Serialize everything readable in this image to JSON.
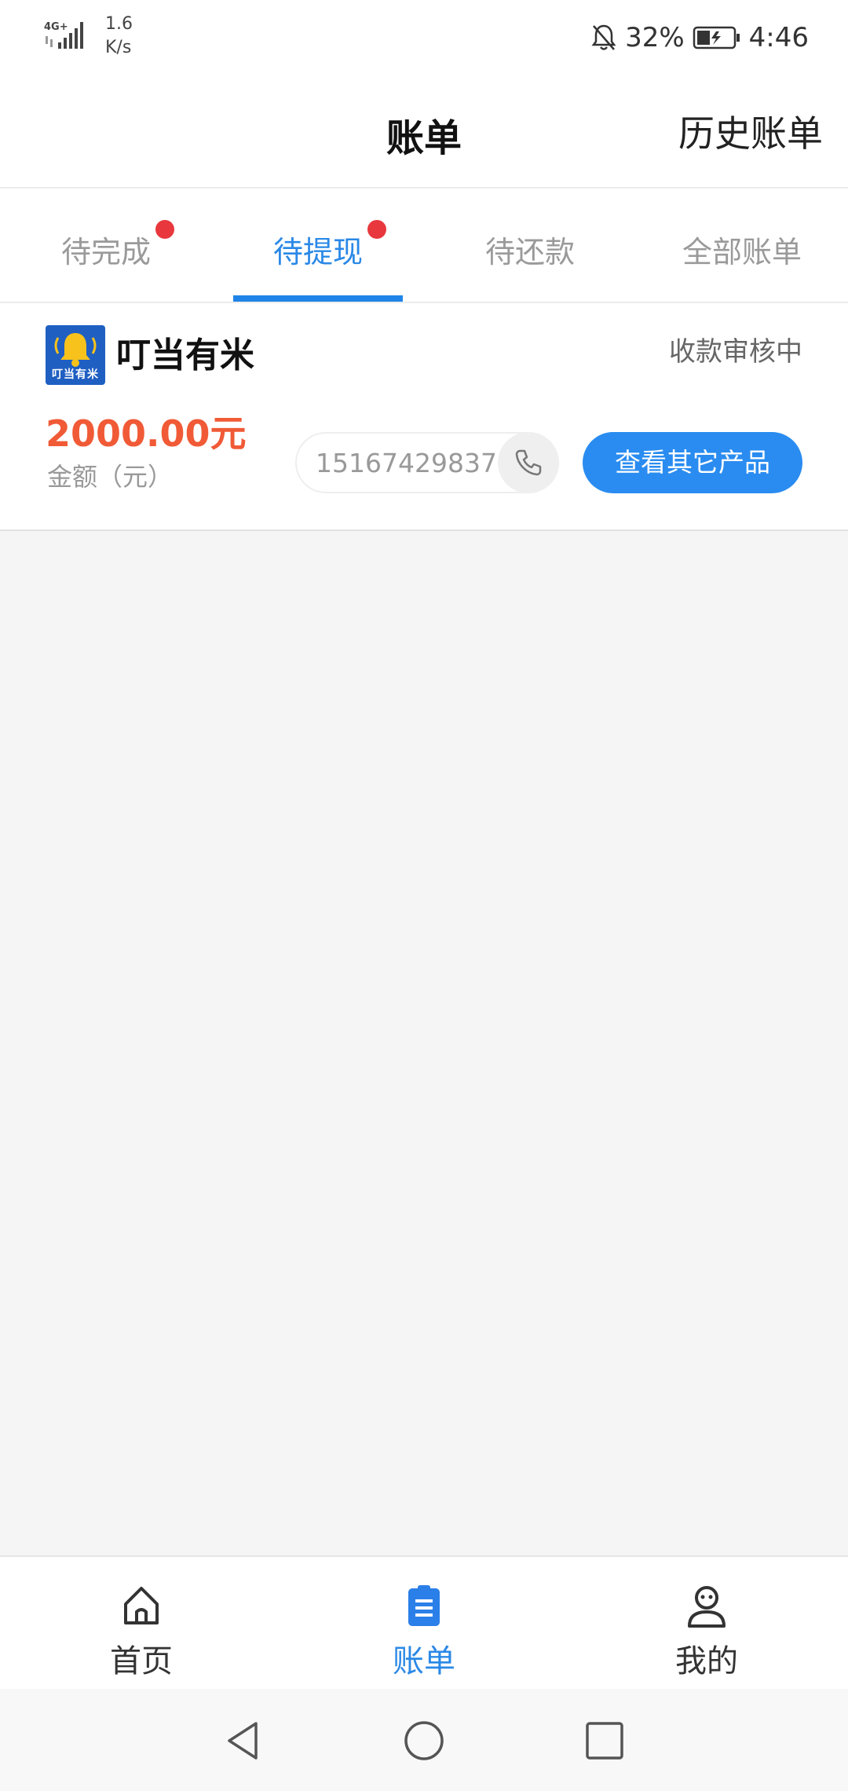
{
  "status_bar": {
    "network_label": "4G+",
    "speed_value": "1.6",
    "speed_unit": "K/s",
    "battery_percent": "32%",
    "time": "4:46",
    "icons": [
      "signal-icon",
      "mute-bell-icon",
      "battery-charging-icon"
    ]
  },
  "header": {
    "title": "账单",
    "history_link": "历史账单"
  },
  "tabs": [
    {
      "label": "待完成",
      "has_dot": true,
      "active": false
    },
    {
      "label": "待提现",
      "has_dot": true,
      "active": true
    },
    {
      "label": "待还款",
      "has_dot": false,
      "active": false
    },
    {
      "label": "全部账单",
      "has_dot": false,
      "active": false
    }
  ],
  "bill_card": {
    "logo_text": "叮当有米",
    "company_name": "叮当有米",
    "status": "收款审核中",
    "amount": "2000.00元",
    "amount_label": "金额（元）",
    "phone": "15167429837",
    "other_products_button": "查看其它产品"
  },
  "bottom_nav": [
    {
      "label": "首页",
      "icon": "home-icon",
      "active": false
    },
    {
      "label": "账单",
      "icon": "bill-icon",
      "active": true
    },
    {
      "label": "我的",
      "icon": "profile-icon",
      "active": false
    }
  ],
  "colors": {
    "accent": "#2a88e6",
    "amount": "#f05a36",
    "badge": "#e8383d",
    "button": "#2a8cf0"
  }
}
